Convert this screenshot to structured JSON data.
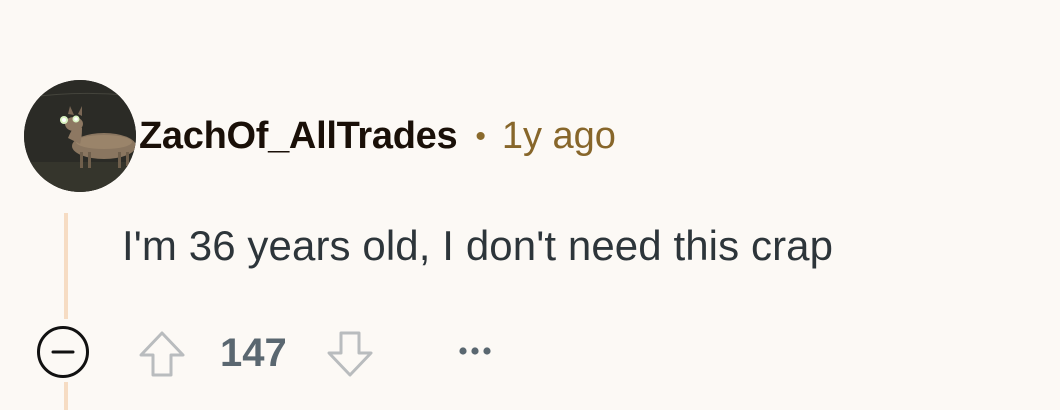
{
  "comment": {
    "username": "ZachOf_AllTrades",
    "separator": "•",
    "timestamp": "1y ago",
    "body": "I'm 36 years old, I don't need this crap",
    "score": "147"
  },
  "colors": {
    "background": "#fcf9f5",
    "username": "#1a1008",
    "timestamp": "#87662a",
    "body": "#2d353a",
    "score": "#5a6770",
    "thread_line": "#f6dcc3"
  },
  "icons": {
    "avatar": "deer-photo-avatar",
    "collapse": "collapse-minus-icon",
    "upvote": "upvote-arrow-icon",
    "downvote": "downvote-arrow-icon",
    "more": "more-options-icon"
  }
}
